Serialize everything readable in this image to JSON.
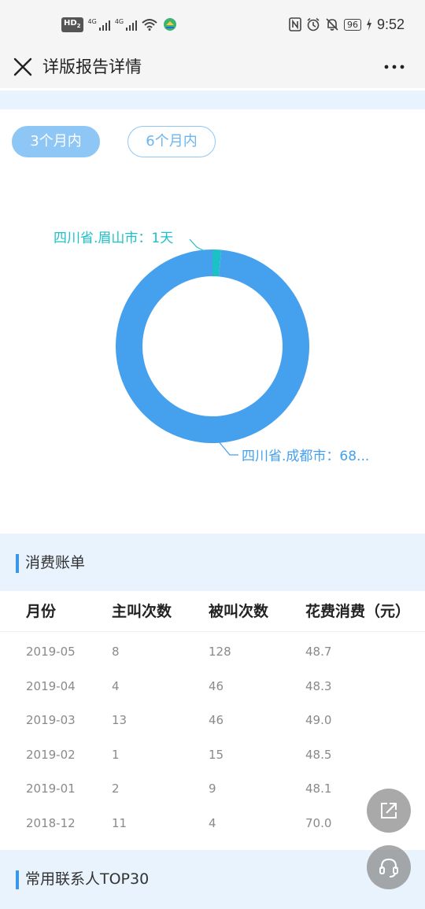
{
  "status_bar": {
    "hd_label": "HD",
    "hd_sub": "2",
    "net1": "4G",
    "net2": "4G",
    "battery": "96",
    "time": "9:52"
  },
  "nav": {
    "title": "详版报告详情"
  },
  "tabs": [
    {
      "label": "3个月内",
      "active": true
    },
    {
      "label": "6个月内",
      "active": false
    }
  ],
  "chart_data": {
    "type": "pie",
    "style": "donut",
    "labels": [
      "四川省.眉山市：1天",
      "四川省.成都市：68..."
    ],
    "values": [
      1,
      68
    ],
    "colors": [
      "#1ec0c8",
      "#45a0ee"
    ]
  },
  "bill_section": {
    "title": "消费账单",
    "columns": [
      "月份",
      "主叫次数",
      "被叫次数",
      "花费消费（元）"
    ],
    "rows": [
      [
        "2019-05",
        "8",
        "128",
        "48.7"
      ],
      [
        "2019-04",
        "4",
        "46",
        "48.3"
      ],
      [
        "2019-03",
        "13",
        "46",
        "49.0"
      ],
      [
        "2019-02",
        "1",
        "15",
        "48.5"
      ],
      [
        "2019-01",
        "2",
        "9",
        "48.1"
      ],
      [
        "2018-12",
        "11",
        "4",
        "70.0"
      ]
    ]
  },
  "contacts_section": {
    "title": "常用联系人TOP30"
  },
  "fabs": [
    {
      "icon": "share-icon"
    },
    {
      "icon": "headset-icon"
    }
  ],
  "colors": {
    "accent": "#3a97e8",
    "section_bg": "#e8f3fd",
    "pill_active": "#8ec7f5"
  }
}
